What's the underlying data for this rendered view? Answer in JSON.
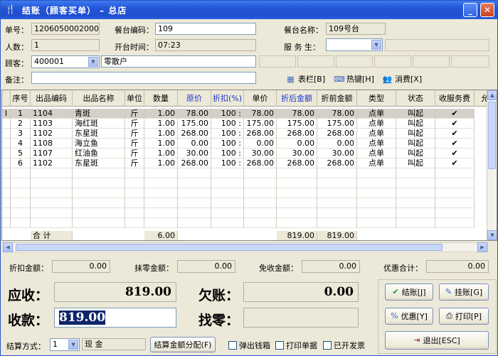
{
  "window": {
    "title": "结账（顾客买单） – 总店"
  },
  "icons": {
    "app": "cutlery-icon",
    "minimize": "minimize-icon",
    "close": "close-icon"
  },
  "form": {
    "order_no_label": "单号：",
    "order_no": "120605000200001",
    "table_code_label": "餐台编码：",
    "table_code": "109",
    "table_name_label": "餐台名称：",
    "table_name": "109号台",
    "people_label": "人数：",
    "people": "1",
    "open_time_label": "开台时间：",
    "open_time": "07:23",
    "waiter_label": "服 务 生：",
    "waiter": "",
    "customer_label": "顾客：",
    "customer_code": "400001",
    "customer_name": "零散户",
    "remark_label": "备注：",
    "remark": ""
  },
  "toolbar": {
    "table_btn": "表栏[B]",
    "hotkey_btn": "热键[H]",
    "consume_btn": "消费[X]"
  },
  "grid": {
    "columns": [
      "序号",
      "出品编码",
      "出品名称",
      "单位",
      "数量",
      "原价",
      "折扣(%)",
      "单价",
      "折后金额",
      "折前金额",
      "类型",
      "状态",
      "收服务费",
      "允"
    ],
    "blue_columns": [
      "原价",
      "折扣(%)",
      "折后金额"
    ],
    "rows": [
      {
        "no": "1",
        "code": "1104",
        "name": "青斑",
        "unit": "斤",
        "qty": "1.00",
        "price": "78.00",
        "disc": "100",
        "unit_price": "78.00",
        "after": "78.00",
        "before": "78.00",
        "type": "点单",
        "status": "叫起",
        "svc": "✔"
      },
      {
        "no": "2",
        "code": "1103",
        "name": "海红斑",
        "unit": "斤",
        "qty": "1.00",
        "price": "175.00",
        "disc": "100",
        "unit_price": "175.00",
        "after": "175.00",
        "before": "175.00",
        "type": "点单",
        "status": "叫起",
        "svc": "✔"
      },
      {
        "no": "3",
        "code": "1102",
        "name": "东星斑",
        "unit": "斤",
        "qty": "1.00",
        "price": "268.00",
        "disc": "100",
        "unit_price": "268.00",
        "after": "268.00",
        "before": "268.00",
        "type": "点单",
        "status": "叫起",
        "svc": "✔"
      },
      {
        "no": "4",
        "code": "1108",
        "name": "海立鱼",
        "unit": "斤",
        "qty": "1.00",
        "price": "0.00",
        "disc": "100",
        "unit_price": "0.00",
        "after": "0.00",
        "before": "0.00",
        "type": "点单",
        "status": "叫起",
        "svc": "✔"
      },
      {
        "no": "5",
        "code": "1107",
        "name": "红油鱼",
        "unit": "斤",
        "qty": "1.00",
        "price": "30.00",
        "disc": "100",
        "unit_price": "30.00",
        "after": "30.00",
        "before": "30.00",
        "type": "点单",
        "status": "叫起",
        "svc": "✔"
      },
      {
        "no": "6",
        "code": "1102",
        "name": "东星斑",
        "unit": "斤",
        "qty": "1.00",
        "price": "268.00",
        "disc": "100",
        "unit_price": "268.00",
        "after": "268.00",
        "before": "268.00",
        "type": "点单",
        "status": "叫起",
        "svc": "✔"
      }
    ],
    "total": {
      "label": "合  计",
      "qty": "6.00",
      "after": "819.00",
      "before": "819.00"
    }
  },
  "summary": {
    "discount_label": "折扣金额：",
    "discount": "0.00",
    "round_label": "抹零金额：",
    "round": "0.00",
    "free_label": "免收金额：",
    "free": "0.00",
    "promo_total_label": "优惠合计：",
    "promo_total": "0.00"
  },
  "pay": {
    "receivable_label": "应收：",
    "receivable": "819.00",
    "owed_label": "欠账：",
    "owed": "0.00",
    "received_label": "收款：",
    "received": "819.00",
    "change_label": "找零：",
    "change": ""
  },
  "bottom": {
    "method_label": "结算方式：",
    "method_code": "1",
    "method_name": "现  金",
    "allocate_btn": "结算金额分配(F)",
    "cash_drawer": "弹出钱箱",
    "print_bill": "打印单据",
    "invoiced": "已开发票"
  },
  "actions": {
    "checkout": "结账[J]",
    "hang": "挂账[G]",
    "discount": "优惠[Y]",
    "print": "打印[P]",
    "exit": "退出[ESC]"
  }
}
